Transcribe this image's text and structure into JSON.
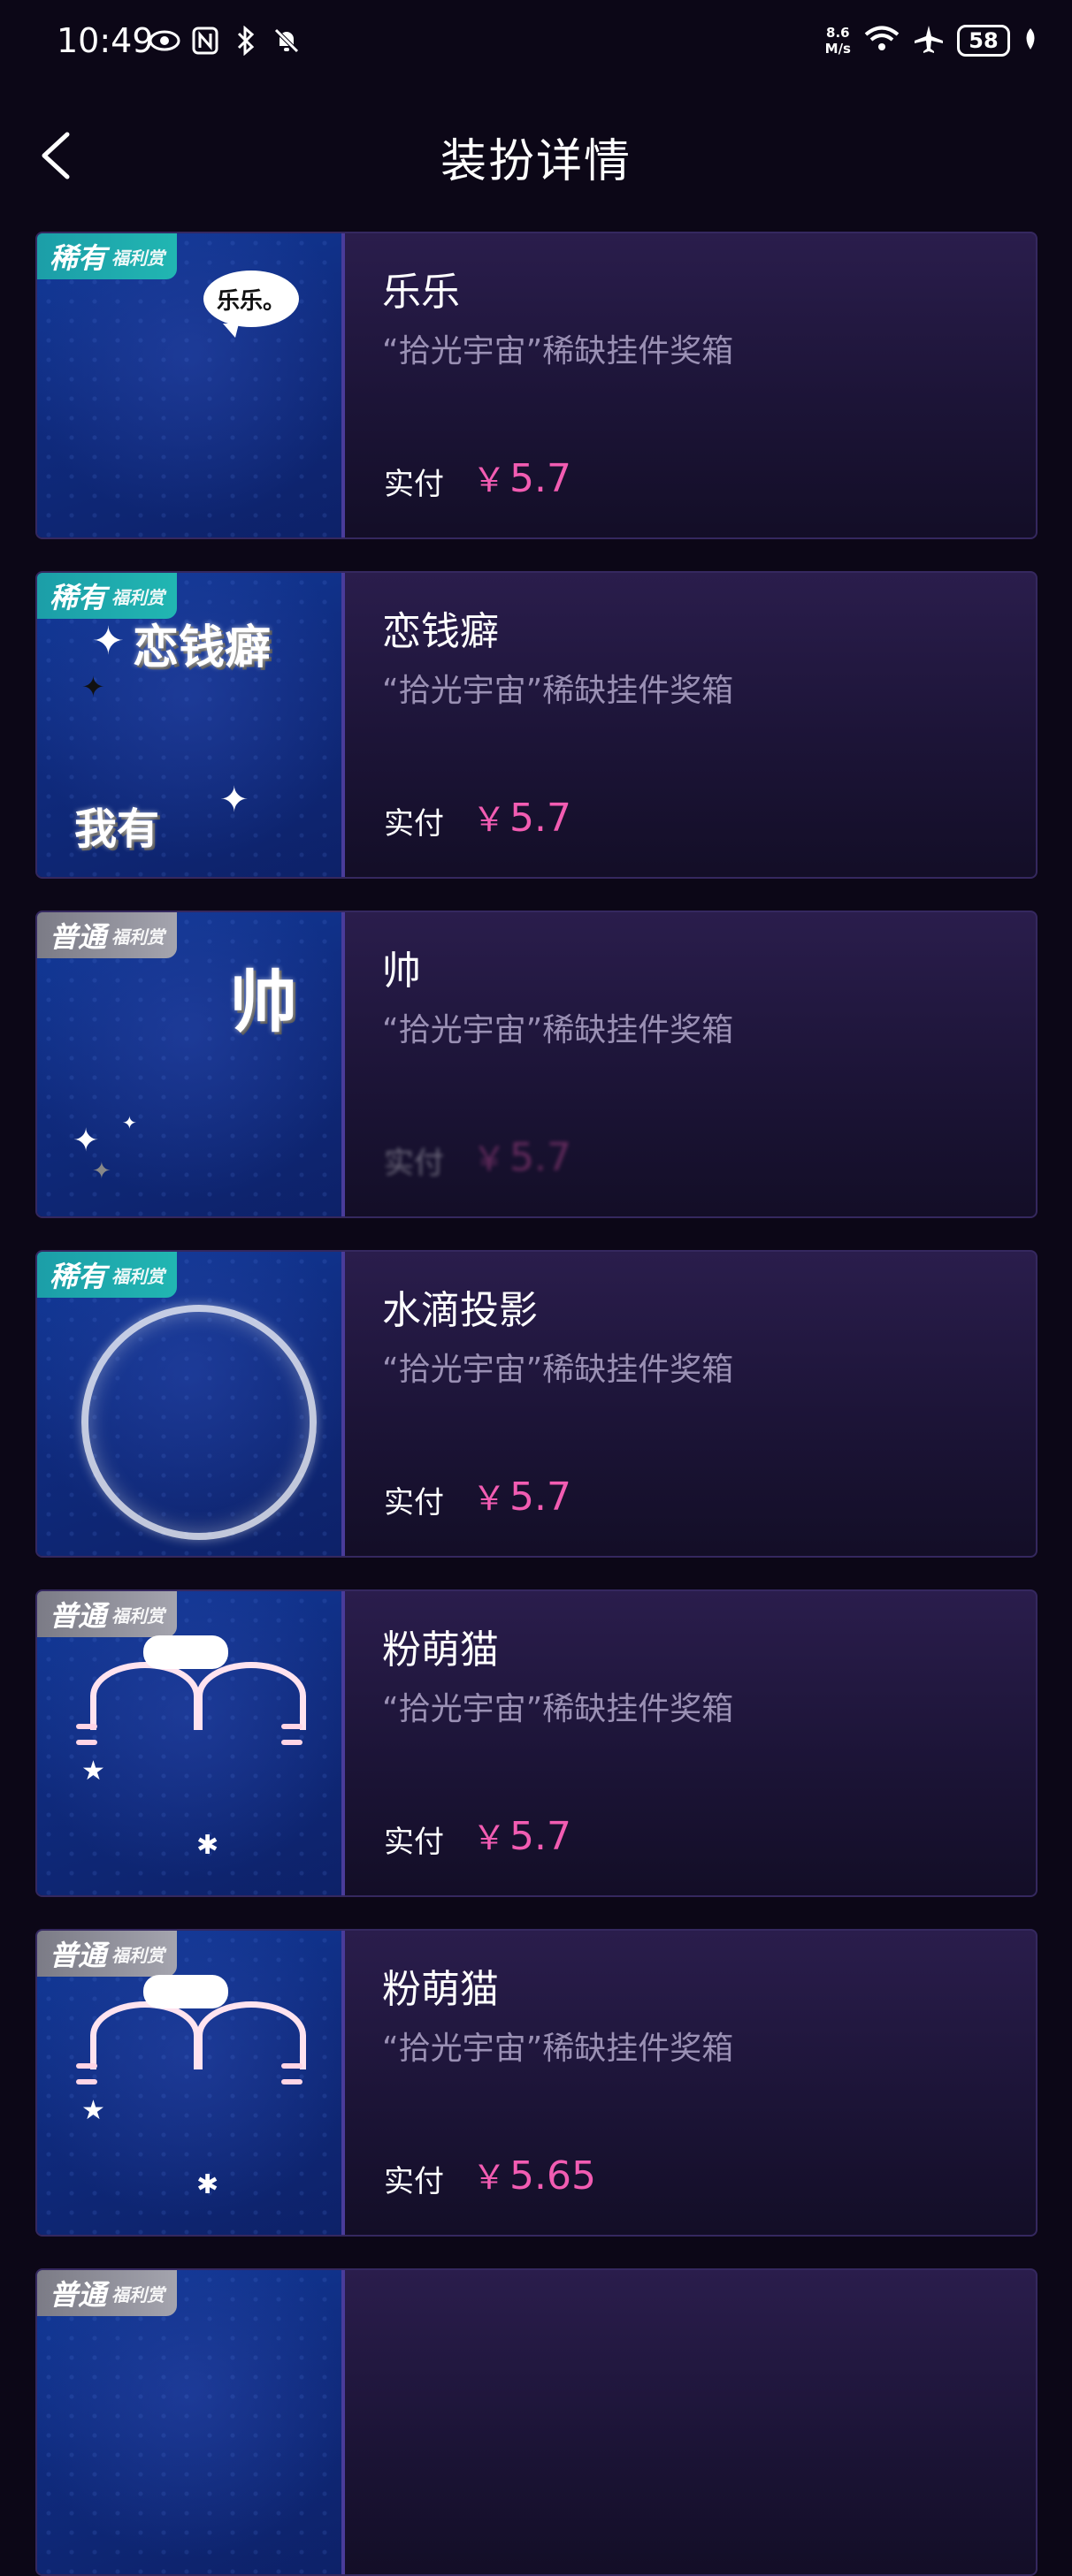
{
  "status_bar": {
    "time": "10:49",
    "net_speed_top": "8.6",
    "net_speed_bottom": "M/s",
    "battery": "58"
  },
  "header": {
    "title": "装扮详情"
  },
  "colors": {
    "price": "#f25cb2",
    "rare_badge": "#1fa9ae",
    "normal_badge": "#8e8e98"
  },
  "items": [
    {
      "badge_type": "rare",
      "badge_main": "稀有",
      "badge_sub": "福利赏",
      "name": "乐乐",
      "source": "“拾光宇宙”稀缺挂件奖箱",
      "price_label": "实付",
      "currency": "￥",
      "price": "5.7",
      "art_text": "乐乐。"
    },
    {
      "badge_type": "rare",
      "badge_main": "稀有",
      "badge_sub": "福利赏",
      "name": "恋钱癖",
      "source": "“拾光宇宙”稀缺挂件奖箱",
      "price_label": "实付",
      "currency": "￥",
      "price": "5.7",
      "art_text": "恋钱癖",
      "art_text2": "我有"
    },
    {
      "badge_type": "normal",
      "badge_main": "普通",
      "badge_sub": "福利赏",
      "name": "帅",
      "source": "“拾光宇宙”稀缺挂件奖箱",
      "price_label": "实付",
      "currency": "￥",
      "price": "5.7",
      "art_text": "帅"
    },
    {
      "badge_type": "rare",
      "badge_main": "稀有",
      "badge_sub": "福利赏",
      "name": "水滴投影",
      "source": "“拾光宇宙”稀缺挂件奖箱",
      "price_label": "实付",
      "currency": "￥",
      "price": "5.7"
    },
    {
      "badge_type": "normal",
      "badge_main": "普通",
      "badge_sub": "福利赏",
      "name": "粉萌猫",
      "source": "“拾光宇宙”稀缺挂件奖箱",
      "price_label": "实付",
      "currency": "￥",
      "price": "5.7"
    },
    {
      "badge_type": "normal",
      "badge_main": "普通",
      "badge_sub": "福利赏",
      "name": "粉萌猫",
      "source": "“拾光宇宙”稀缺挂件奖箱",
      "price_label": "实付",
      "currency": "￥",
      "price": "5.65"
    },
    {
      "badge_type": "normal",
      "badge_main": "普通",
      "badge_sub": "福利赏",
      "name": "",
      "source": "",
      "price_label": "",
      "currency": "",
      "price": ""
    }
  ]
}
